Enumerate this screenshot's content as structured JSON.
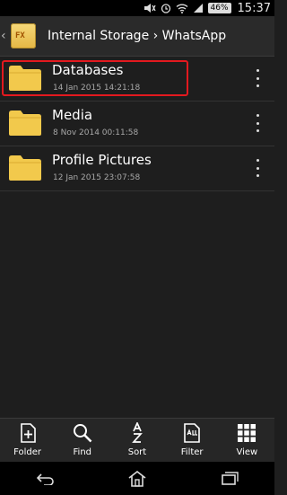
{
  "status_bar": {
    "battery": "46%",
    "time": "15:37"
  },
  "app_bar": {
    "logo_text": "FX",
    "path": "Internal Storage › WhatsApp"
  },
  "files": [
    {
      "name": "Databases",
      "date": "14 Jan 2015 14:21:18",
      "highlighted": true
    },
    {
      "name": "Media",
      "date": "8 Nov 2014 00:11:58"
    },
    {
      "name": "Profile Pictures",
      "date": "12 Jan 2015 23:07:58"
    }
  ],
  "toolbar": {
    "folder": "Folder",
    "find": "Find",
    "sort": "Sort",
    "filter": "Filter",
    "view": "View"
  },
  "colors": {
    "highlight": "#e3191f",
    "folder": "#f2c94c",
    "background": "#1e1e1e"
  }
}
